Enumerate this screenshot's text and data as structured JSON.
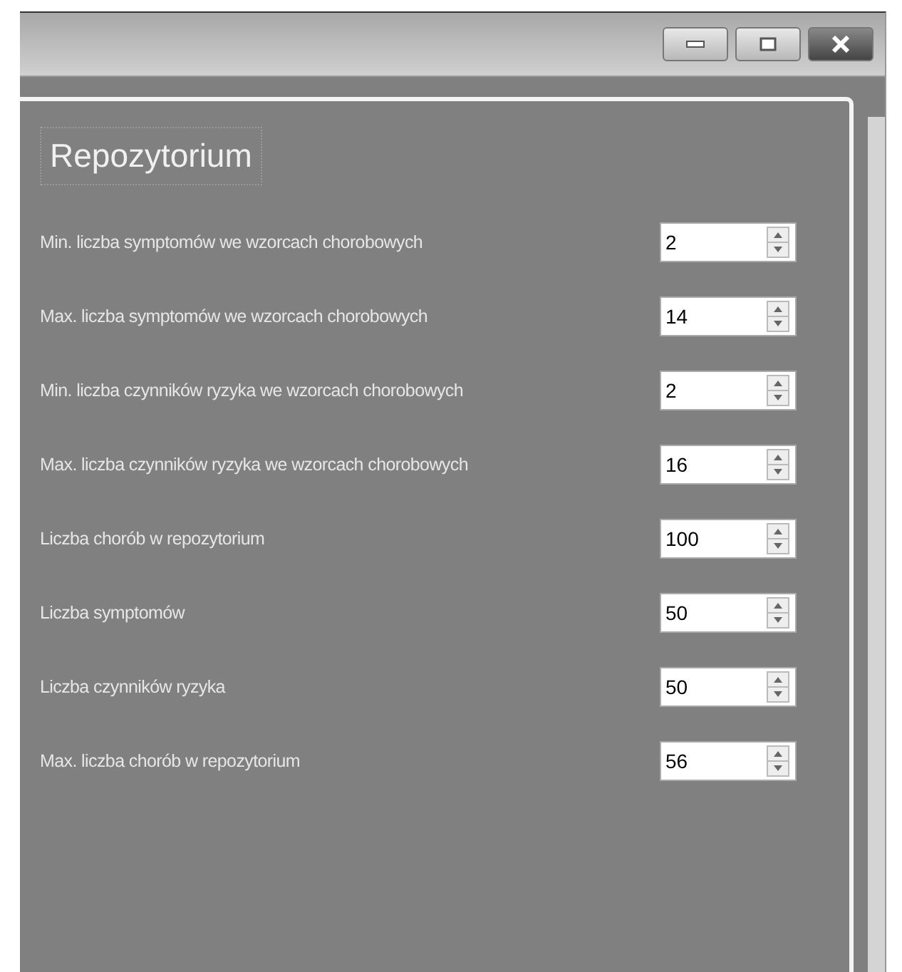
{
  "group": {
    "title": "Repozytorium"
  },
  "fields": [
    {
      "label": "Min. liczba symptomów we wzorcach chorobowych",
      "value": "2"
    },
    {
      "label": "Max. liczba symptomów we wzorcach chorobowych",
      "value": "14"
    },
    {
      "label": "Min. liczba czynników ryzyka we wzorcach chorobowych",
      "value": "2"
    },
    {
      "label": "Max. liczba czynników ryzyka we wzorcach chorobowych",
      "value": "16"
    },
    {
      "label": "Liczba chorób w repozytorium",
      "value": "100"
    },
    {
      "label": "Liczba symptomów",
      "value": "50"
    },
    {
      "label": "Liczba czynników ryzyka",
      "value": "50"
    },
    {
      "label": "Max. liczba chorób w repozytorium",
      "value": "56"
    }
  ]
}
